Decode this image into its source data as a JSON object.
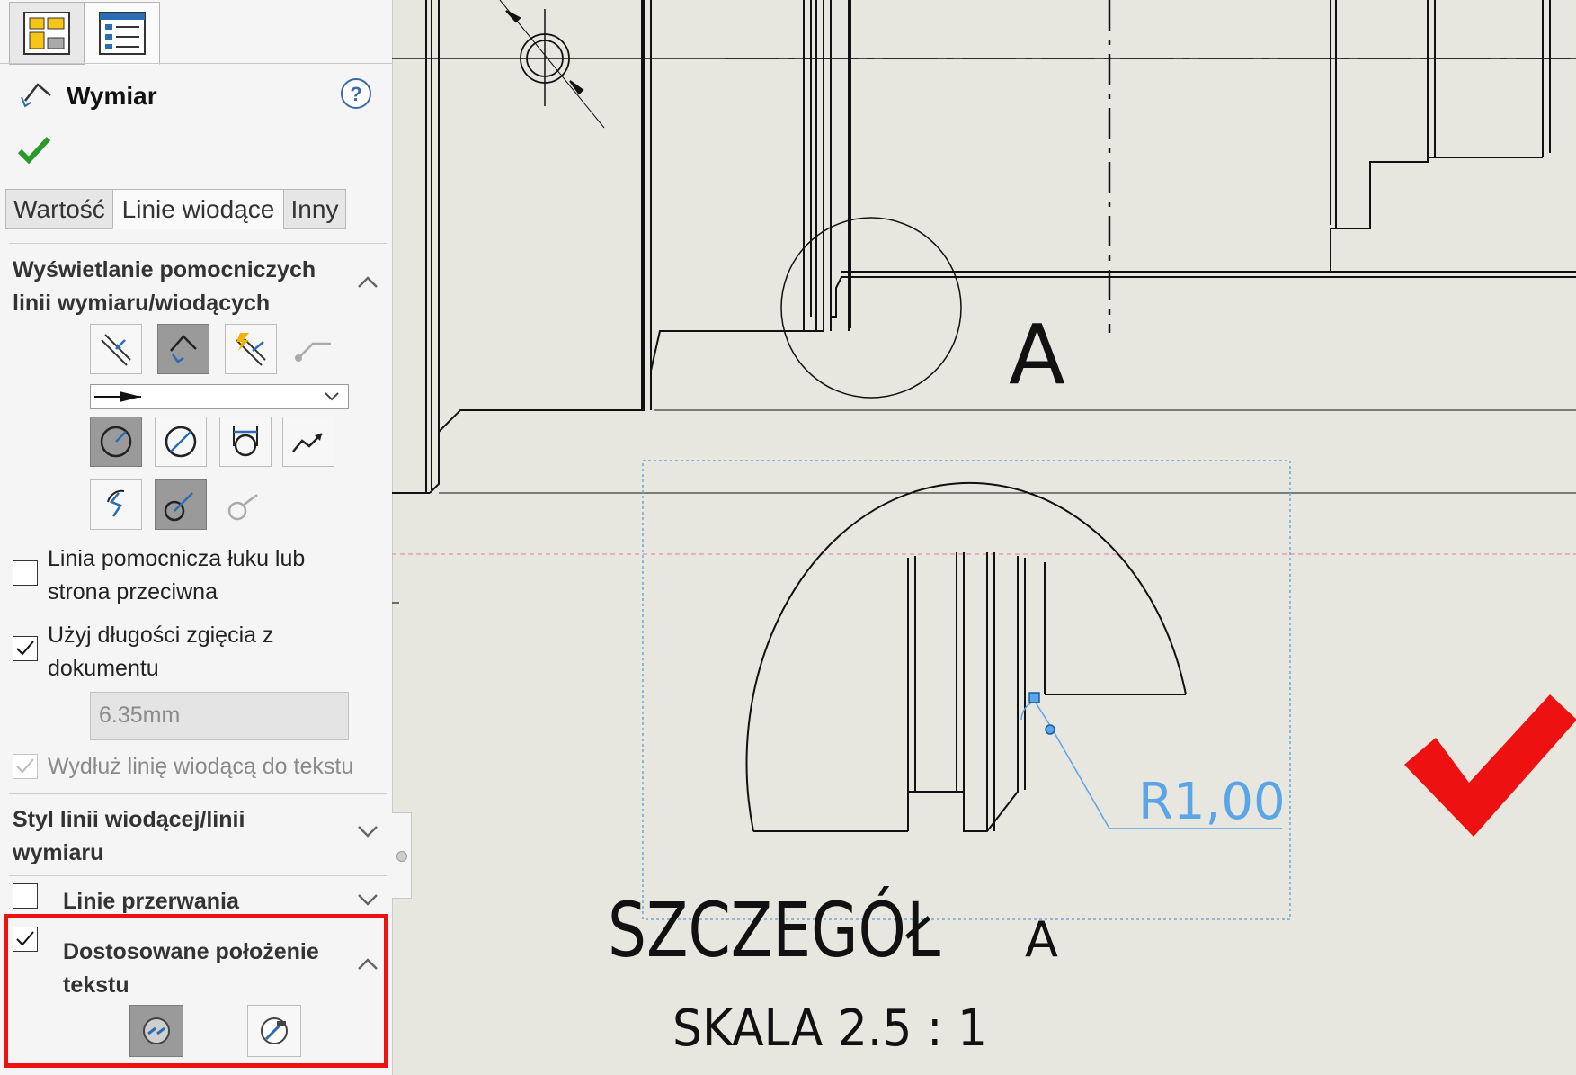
{
  "panel": {
    "title": "Wymiar",
    "tabs": [
      "Wartość",
      "Linie wiodące",
      "Inny"
    ],
    "active_tab": "Linie wiodące",
    "section_display": {
      "title_line1": "Wyświetlanie pomocniczych",
      "title_line2": "linii wymiaru/wiodących",
      "arrow_style_select": "arrow-filled",
      "arc_extension_checkbox": {
        "line1": "Linia pomocnicza łuku lub",
        "line2": "strona przeciwna",
        "checked": false
      },
      "bent_length_checkbox": {
        "line1": "Użyj długości zgięcia z",
        "line2": "dokumentu",
        "checked": true
      },
      "bent_length_value": "6.35mm",
      "extend_leader_checkbox": {
        "label": "Wydłuż linię wiodącą do tekstu",
        "checked": true,
        "disabled": true
      }
    },
    "section_style": {
      "title_line1": "Styl linii wiodącej/linii",
      "title_line2": "wymiaru"
    },
    "section_breaks": {
      "title": "Linie przerwania",
      "checked": false
    },
    "section_custom_text": {
      "title_line1": "Dostosowane położenie",
      "title_line2": "tekstu",
      "checked": true
    },
    "colors": {
      "highlight": "#ee1111",
      "ok": "#2a9a2a",
      "blue_dim": "#5aa5e8"
    }
  },
  "drawing": {
    "view_label": "A",
    "dimension_text": "R1,00",
    "detail_title": "SZCZEGÓŁ",
    "detail_letter": "A",
    "scale_text": "SKALA  2.5 : 1"
  }
}
